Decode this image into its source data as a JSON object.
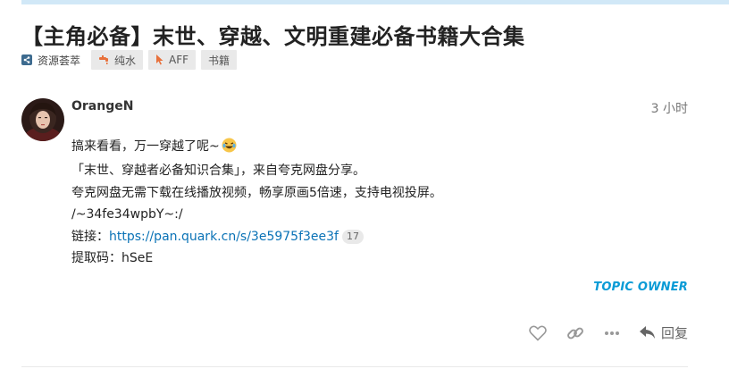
{
  "topic": {
    "title": "【主角必备】末世、穿越、文明重建必备书籍大合集",
    "category": "资源荟萃",
    "tags": [
      "纯水",
      "AFF",
      "书籍"
    ]
  },
  "post": {
    "username": "OrangeN",
    "time": "3 小时",
    "lines": [
      "搞来看看，万一穿越了呢~",
      "「末世、穿越者必备知识合集」，来自夸克网盘分享。",
      "夸克网盘无需下载在线播放视频，畅享原画5倍速，支持电视投屏。",
      "/~34fe34wpbY~:/"
    ],
    "link_label": "链接：",
    "link_url": "https://pan.quark.cn/s/3e5975f3ee3f",
    "link_clicks": "17",
    "code_line": "提取码：hSeE",
    "owner_badge": "TOPIC OWNER",
    "reply_label": "回复"
  },
  "icons": {
    "category": "share-icon",
    "tag1": "faucet-icon",
    "tag2": "cursor-icon",
    "emoji": "laughing-emoji",
    "like": "heart-icon",
    "link": "link-icon",
    "more": "more-icon",
    "reply": "reply-icon"
  },
  "colors": {
    "link": "#0a72b6",
    "owner_badge": "#0a9bd6",
    "category": "#3d6b8f",
    "faucet": "#e8713c",
    "cursor": "#e8713c"
  }
}
